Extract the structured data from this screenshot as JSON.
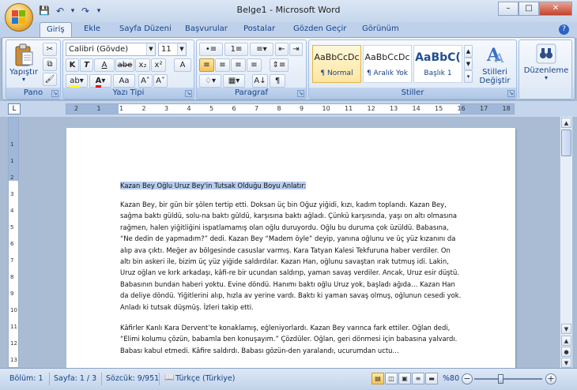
{
  "window": {
    "title": "Belge1 - Microsoft Word",
    "minimize": "–",
    "maximize": "□",
    "close": "✕"
  },
  "qat": {
    "save_icon": "💾",
    "undo_icon": "↶",
    "dropdown": "▾",
    "redo_icon": "↷",
    "customize": "▾"
  },
  "tabs": [
    "Giriş",
    "Ekle",
    "Sayfa Düzeni",
    "Başvurular",
    "Postalar",
    "Gözden Geçir",
    "Görünüm"
  ],
  "help_icon": "?",
  "ribbon": {
    "clipboard": {
      "label": "Pano",
      "paste": "Yapıştır",
      "paste_arrow": "▾"
    },
    "font": {
      "label": "Yazı Tipi",
      "font_name": "Calibri (Gövde)",
      "font_size": "11",
      "bold": "K",
      "italic": "T",
      "underline": "A",
      "strike": "abe",
      "subscript": "x₂",
      "superscript": "x²",
      "change_case": "Aa",
      "grow": "A˄",
      "shrink": "A˅",
      "clear": "A"
    },
    "paragraph": {
      "label": "Paragraf",
      "pilcrow": "¶",
      "sort": "A↓"
    },
    "styles": {
      "label": "Stiller",
      "items": [
        {
          "preview": "AaBbCcDc",
          "name": "¶ Normal"
        },
        {
          "preview": "AaBbCcDc",
          "name": "¶ Aralık Yok"
        },
        {
          "preview": "AaBbC(",
          "name": "Başlık 1"
        }
      ],
      "change_styles": "Stilleri Değiştir"
    },
    "editing": {
      "label": "Düzenleme"
    }
  },
  "ruler": {
    "tab_selector": "L",
    "ticks": [
      "2",
      "1",
      "1",
      "2",
      "3",
      "4",
      "5",
      "6",
      "7",
      "8",
      "9",
      "10",
      "11",
      "12",
      "13",
      "14",
      "15",
      "16",
      "17",
      "18"
    ],
    "vticks": [
      "1",
      "1",
      "2",
      "3",
      "4",
      "5",
      "6",
      "7",
      "8",
      "9",
      "10",
      "11",
      "12",
      "13"
    ]
  },
  "document": {
    "heading": "Kazan Bey Oğlu Uruz Bey'in Tutsak Olduğu Boyu Anlatır:",
    "paragraph1": [
      "Kazan Bey, bir gün bir şölen tertip etti. Doksan üç bin Oğuz yiğidi, kızı, kadım toplandı. Kazan Bey,",
      "sağma baktı güldü, solu-na baktı güldü, karşısına baktı ağladı. Çünkü karşısında, yaşı on altı olmasına",
      "rağmen, halen yiğitliğini ispatlamamış olan oğlu duruyordu. Oğlu bu duruma çok üzüldü. Babasına,",
      "“Ne dedin de yapmadım?” dedi. Kazan Bey “Madem öyle” deyip, yanına oğlunu ve üç yüz kızanını da",
      "alıp ava çıktı. Meğer av bölgesinde casuslar varmış. Kara Tatyan Kalesi Tekfuruna haber verdiler. On",
      "altı bin askeri ile, bizim üç yüz yiğide saldırdılar. Kazan Han, oğlunu savaştan ırak tutmuş idi. Lakin,",
      "Uruz oğlan ve kırk arkadaşı, kâfi-re bir ucundan saldırıp, yaman savaş verdiler. Ancak, Uruz esir düştü.",
      "Babasının bundan haberi yoktu. Evine döndü. Hanımı baktı oğlu Uruz yok, başladı ağıda… Kazan Han",
      "da deliye döndü. Yiğitlerini alıp, hızla av yerine vardı. Baktı ki yaman savaş olmuş, oğlunun cesedi yok.",
      "Anladı ki tutsak düşmüş. İzleri takip etti."
    ],
    "paragraph2": [
      "Kâfirler Kanlı Kara Dervent’te konaklamış, eğleniyorlardı. Kazan Bey varınca fark ettiler. Oğlan dedi,",
      "“Elimi kolumu çözün, babamla ben konuşayım.” Çözdüler. Oğlan, geri dönmesi için babasına yalvardı.",
      "Babası kabul etmedi. Kâfire saldırdı. Babası gözün-den yaralandı, ucurumdan uctu…"
    ]
  },
  "status": {
    "section": "Bölüm: 1",
    "page": "Sayfa: 1 / 3",
    "words": "Sözcük: 9/951",
    "language": "Türkçe (Türkiye)",
    "zoom": "%80",
    "zoom_minus": "−",
    "zoom_plus": "+",
    "zoom_level": 0.8
  },
  "colors": {
    "ribbon_bg": "#dce7f5",
    "accent": "#15428b",
    "selection": "#b8cdee"
  }
}
